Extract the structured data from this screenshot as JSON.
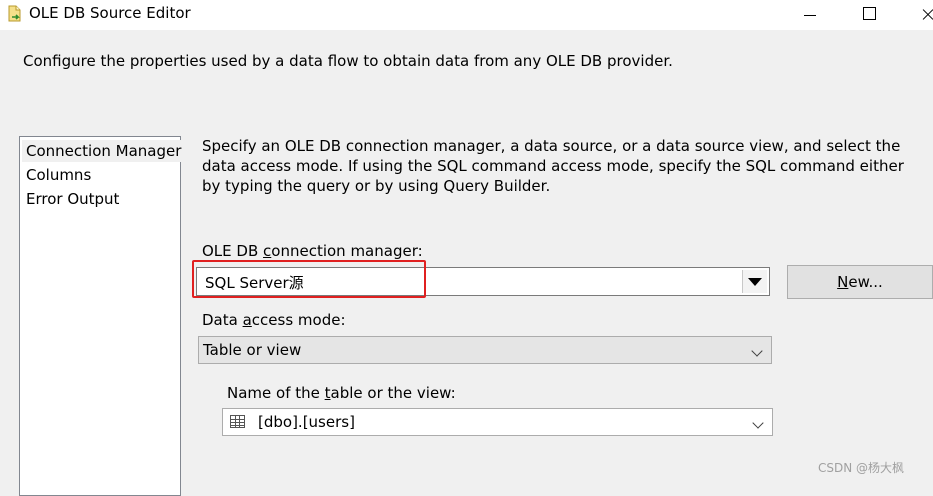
{
  "window": {
    "title": "OLE DB Source Editor",
    "icon": "package-icon"
  },
  "header": {
    "description": "Configure the properties used by a data flow to obtain data from any OLE DB provider."
  },
  "nav": {
    "items": [
      {
        "label": "Connection Manager",
        "selected": true
      },
      {
        "label": "Columns",
        "selected": false
      },
      {
        "label": "Error Output",
        "selected": false
      }
    ]
  },
  "main": {
    "description": "Specify an OLE DB connection manager, a data source, or a data source view, and select the data access mode. If using the SQL command access mode, specify the SQL command either by typing the query or by using Query Builder.",
    "connection_manager": {
      "label_pre": "OLE DB ",
      "label_accel": "c",
      "label_post": "onnection manager:",
      "value": "SQL Server源"
    },
    "new_button": {
      "accel": "N",
      "rest": "ew..."
    },
    "access_mode": {
      "label_pre": "Data ",
      "label_accel": "a",
      "label_post": "ccess mode:",
      "value": "Table or view"
    },
    "table_name": {
      "label_pre": "Name of the ",
      "label_accel": "t",
      "label_post": "able or the view:",
      "value": "[dbo].[users]",
      "icon": "table-icon"
    }
  },
  "watermark": "CSDN @杨大枫",
  "colors": {
    "highlight": "#e02020",
    "window_bg": "#f0f0f0"
  }
}
